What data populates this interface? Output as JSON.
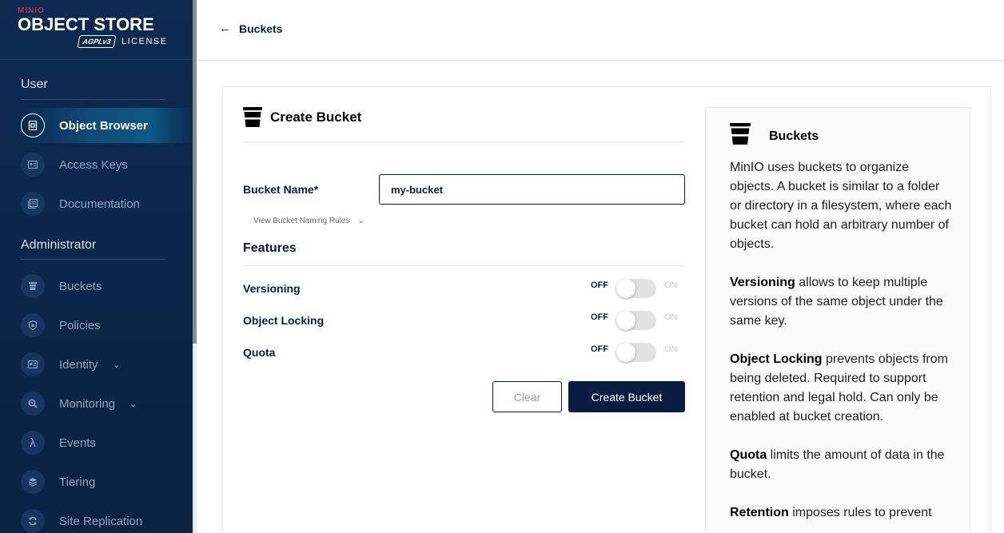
{
  "sidebar": {
    "logo": {
      "brand": "MINIO",
      "product": "OBJECT STORE",
      "badge": "AGPLv3",
      "license": "LICENSE"
    },
    "user_section": "User",
    "user_items": [
      {
        "label": "Object Browser",
        "icon": "object-browser-icon"
      },
      {
        "label": "Access Keys",
        "icon": "access-keys-icon"
      },
      {
        "label": "Documentation",
        "icon": "documentation-icon"
      }
    ],
    "admin_section": "Administrator",
    "admin_items": [
      {
        "label": "Buckets",
        "icon": "buckets-icon"
      },
      {
        "label": "Policies",
        "icon": "policies-icon"
      },
      {
        "label": "Identity",
        "icon": "identity-icon"
      },
      {
        "label": "Monitoring",
        "icon": "monitoring-icon"
      },
      {
        "label": "Events",
        "icon": "events-icon"
      },
      {
        "label": "Tiering",
        "icon": "tiering-icon"
      },
      {
        "label": "Site Replication",
        "icon": "site-replication-icon"
      }
    ]
  },
  "header": {
    "back_label": "Buckets"
  },
  "form": {
    "title": "Create Bucket",
    "bucket_name_label": "Bucket Name*",
    "bucket_name_value": "my-bucket",
    "naming_rules_label": "View Bucket Naming Rules",
    "features_title": "Features",
    "features": [
      {
        "label": "Versioning",
        "off": "OFF",
        "on": "ON",
        "enabled": false
      },
      {
        "label": "Object Locking",
        "off": "OFF",
        "on": "ON",
        "enabled": false
      },
      {
        "label": "Quota",
        "off": "OFF",
        "on": "ON",
        "enabled": false
      }
    ],
    "clear_label": "Clear",
    "create_label": "Create Bucket"
  },
  "help": {
    "title": "Buckets",
    "intro": "MinIO uses buckets to organize objects. A bucket is similar to a folder or directory in a filesystem, where each bucket can hold an arbitrary number of objects.",
    "versioning_term": "Versioning",
    "versioning_text": " allows to keep multiple versions of the same object under the same key.",
    "locking_term": "Object Locking",
    "locking_text": " prevents objects from being deleted. Required to support retention and legal hold. Can only be enabled at bucket creation.",
    "quota_term": "Quota",
    "quota_text": " limits the amount of data in the bucket.",
    "retention_term": "Retention",
    "retention_text": " imposes rules to prevent"
  },
  "colors": {
    "navy": "#081c42",
    "sidebar": "#0b2547",
    "accent": "#c72c48"
  }
}
